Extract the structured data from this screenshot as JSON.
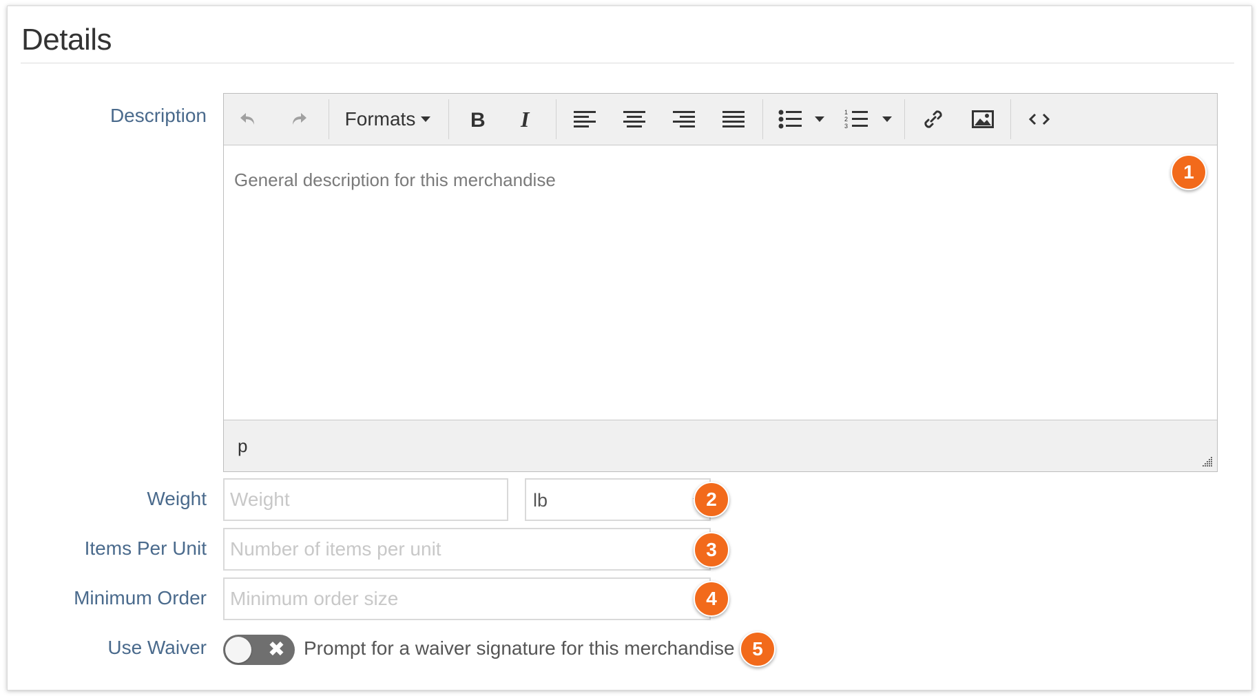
{
  "section": {
    "title": "Details"
  },
  "description": {
    "label": "Description",
    "toolbar": {
      "formats_label": "Formats",
      "undo_icon": "undo-icon",
      "redo_icon": "redo-icon"
    },
    "placeholder": "General description for this merchandise",
    "status_path": "p",
    "badge": "1"
  },
  "weight": {
    "label": "Weight",
    "placeholder": "Weight",
    "unit_value": "lb",
    "badge": "2"
  },
  "items_per_unit": {
    "label": "Items Per Unit",
    "placeholder": "Number of items per unit",
    "badge": "3"
  },
  "minimum_order": {
    "label": "Minimum Order",
    "placeholder": "Minimum order size",
    "badge": "4"
  },
  "use_waiver": {
    "label": "Use Waiver",
    "enabled": false,
    "text": "Prompt for a waiver signature for this merchandise",
    "badge": "5"
  },
  "colors": {
    "label": "#4a6a8c",
    "badge": "#f26a1b",
    "toggle_off": "#6f6f6f"
  }
}
